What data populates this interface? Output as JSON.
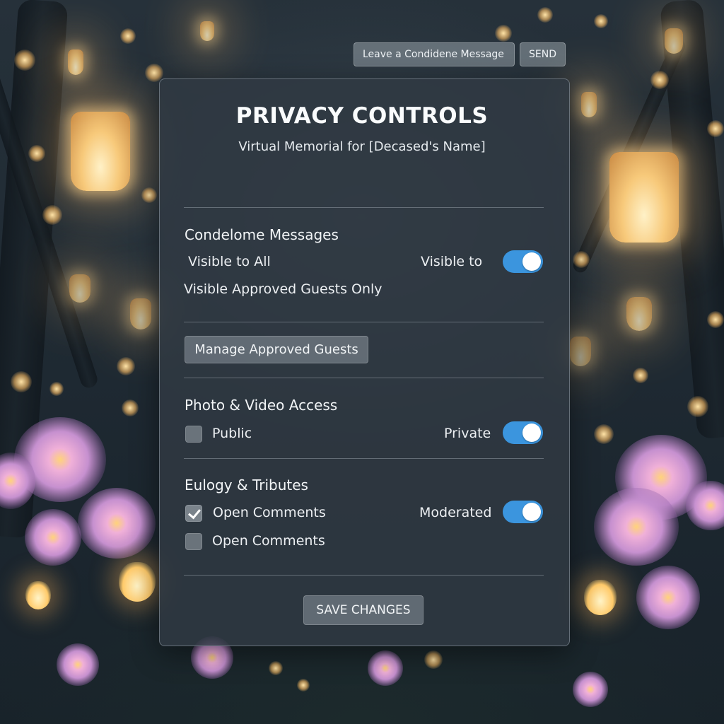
{
  "message_bar": {
    "input_placeholder": "Leave a Condidene Message",
    "send_label": "SEND"
  },
  "panel": {
    "title": "PRIVACY CONTROLS",
    "subtitle": "Virtual Memorial for [Decased's Name]"
  },
  "condolence": {
    "title": "Condelome Messages",
    "option_all": "Visible to All",
    "toggle_label": "Visible to",
    "toggle_on": true,
    "option_approved": "Visible Approved Guests Only"
  },
  "manage_guests": {
    "label": "Manage Approved Guests"
  },
  "photo_video": {
    "title": "Photo & Video Access",
    "public_label": "Public",
    "public_checked": false,
    "toggle_label": "Private",
    "toggle_on": true
  },
  "eulogy": {
    "title": "Eulogy & Tributes",
    "open_comments_1": "Open Comments",
    "open_comments_1_checked": true,
    "toggle_label": "Moderated",
    "toggle_on": true,
    "open_comments_2": "Open Comments",
    "open_comments_2_checked": false
  },
  "save_label": "SAVE CHANGES",
  "colors": {
    "toggle_on": "#3b95de",
    "panel_bg": "#30393f"
  }
}
